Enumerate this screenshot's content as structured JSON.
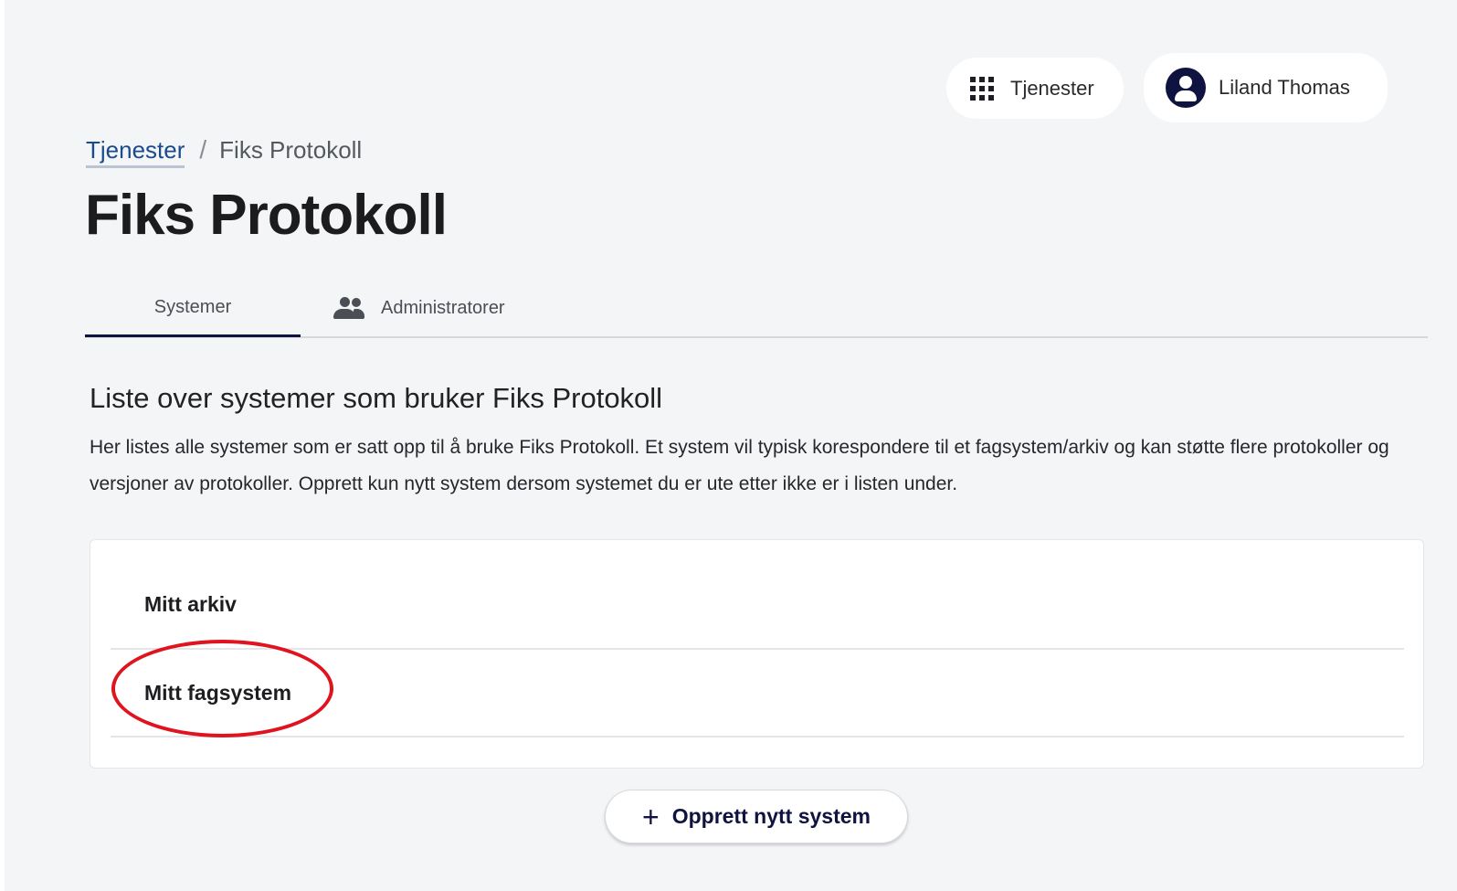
{
  "header": {
    "services_label": "Tjenester",
    "user_name": "Liland Thomas"
  },
  "breadcrumb": {
    "parent": "Tjenester",
    "separator": "/",
    "current": "Fiks Protokoll"
  },
  "page": {
    "title": "Fiks Protokoll"
  },
  "tabs": [
    {
      "label": "Systemer",
      "active": true
    },
    {
      "label": "Administratorer",
      "icon": "people-icon",
      "active": false
    }
  ],
  "section": {
    "heading": "Liste over systemer som bruker Fiks Protokoll",
    "description": "Her listes alle systemer som er satt opp til å bruke Fiks Protokoll. Et system vil typisk korespondere til et fagsystem/arkiv og kan støtte flere protokoller og versjoner av protokoller. Opprett kun nytt system dersom systemet du er ute etter ikke er i listen under."
  },
  "systems": [
    {
      "name": "Mitt arkiv"
    },
    {
      "name": "Mitt fagsystem"
    }
  ],
  "actions": {
    "create_label": "Opprett nytt system",
    "create_icon": "plus-icon"
  },
  "colors": {
    "accent": "#0f1340",
    "link": "#1a4b8c",
    "highlight": "#e0141f",
    "background": "#f4f5f7"
  }
}
